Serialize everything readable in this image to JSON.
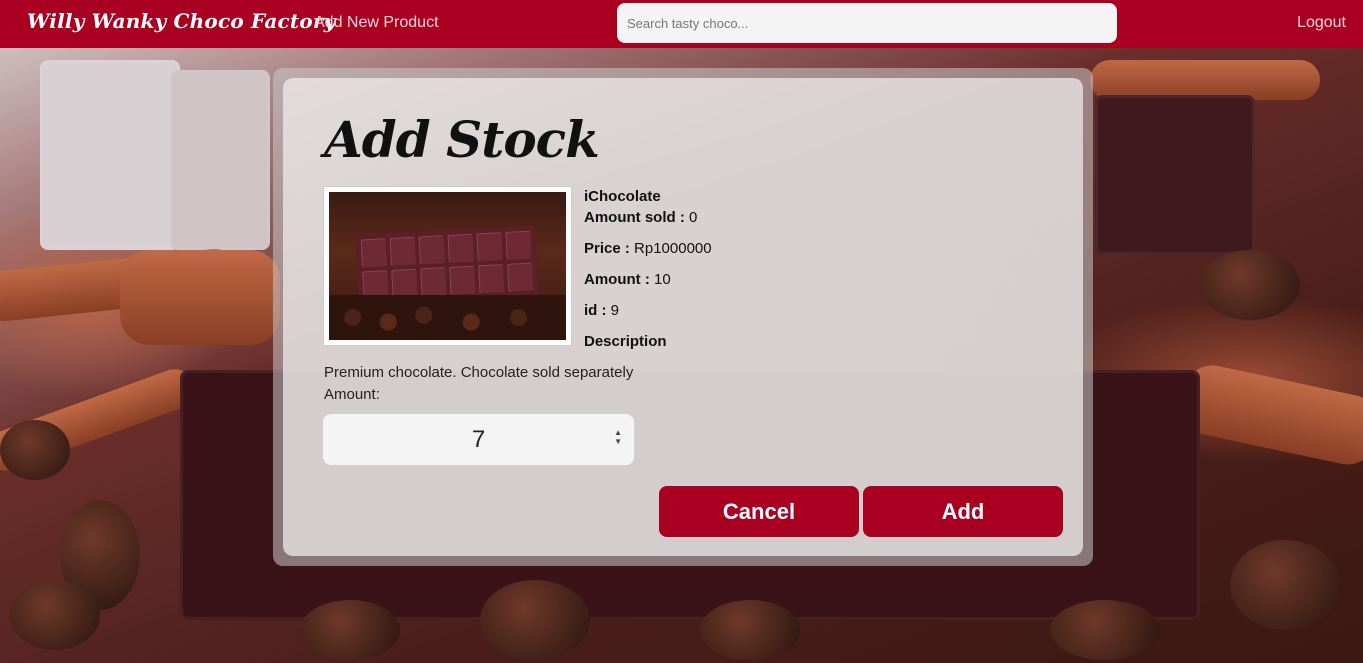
{
  "navbar": {
    "brand": "Willy Wanky Choco Factory",
    "add_product": "Add New Product",
    "search_placeholder": "Search tasty choco...",
    "logout": "Logout"
  },
  "page": {
    "title": "Add Stock"
  },
  "product": {
    "name": "iChocolate",
    "amount_sold_label": "Amount sold :",
    "amount_sold": "0",
    "price_label": "Price :",
    "price": "Rp1000000",
    "amount_label": "Amount :",
    "amount": "10",
    "id_label": "id :",
    "id": "9",
    "description_label": "Description",
    "description": "Premium chocolate. Chocolate sold separately"
  },
  "form": {
    "amount_label": "Amount:",
    "amount_value": "7",
    "cancel_label": "Cancel",
    "add_label": "Add"
  },
  "colors": {
    "accent": "#a90021"
  }
}
